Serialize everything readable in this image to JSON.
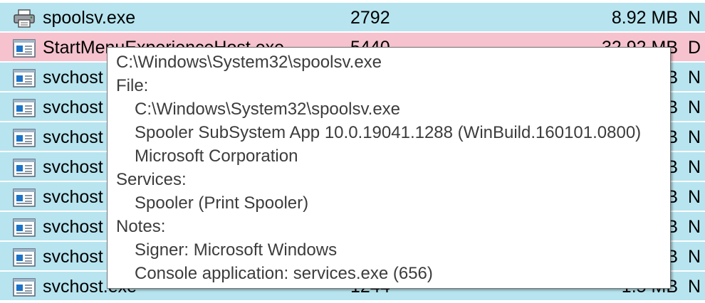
{
  "colors": {
    "service_row": "#b7e4ef",
    "selected_row": "#f5c2cd",
    "tooltip_bg": "#ffffff",
    "tooltip_border": "#767676"
  },
  "rows": [
    {
      "name": "spoolsv.exe",
      "pid": "2792",
      "mem": "8.92 MB",
      "extra": "N",
      "icon": "printer-icon",
      "type": "service"
    },
    {
      "name": "StartMenuExperienceHost.exe",
      "pid": "5440",
      "mem": "32.92 MB",
      "extra": "D",
      "icon": "app-window-icon",
      "type": "selected"
    },
    {
      "name": "svchost",
      "pid": "",
      "mem": "B",
      "extra": "N",
      "icon": "app-window-icon",
      "type": "service"
    },
    {
      "name": "svchost",
      "pid": "",
      "mem": "B",
      "extra": "N",
      "icon": "app-window-icon",
      "type": "service"
    },
    {
      "name": "svchost",
      "pid": "",
      "mem": "B",
      "extra": "N",
      "icon": "app-window-icon",
      "type": "service"
    },
    {
      "name": "svchost",
      "pid": "",
      "mem": "B",
      "extra": "N",
      "icon": "app-window-icon",
      "type": "service"
    },
    {
      "name": "svchost",
      "pid": "",
      "mem": "B",
      "extra": "N",
      "icon": "app-window-icon",
      "type": "service"
    },
    {
      "name": "svchost",
      "pid": "",
      "mem": "B",
      "extra": "N",
      "icon": "app-window-icon",
      "type": "service"
    },
    {
      "name": "svchost",
      "pid": "",
      "mem": "B",
      "extra": "N",
      "icon": "app-window-icon",
      "type": "service"
    },
    {
      "name": "svchost.exe",
      "pid": "1244",
      "mem": "1.5 MB",
      "extra": "N",
      "icon": "app-window-icon",
      "type": "service"
    }
  ],
  "tooltip": {
    "path": "C:\\Windows\\System32\\spoolsv.exe",
    "file_header": "File:",
    "file_path": "C:\\Windows\\System32\\spoolsv.exe",
    "file_description": "Spooler SubSystem App 10.0.19041.1288 (WinBuild.160101.0800)",
    "company": "Microsoft Corporation",
    "services_header": "Services:",
    "service": "Spooler (Print Spooler)",
    "notes_header": "Notes:",
    "signer": "Signer: Microsoft Windows",
    "console": "Console application: services.exe (656)"
  }
}
